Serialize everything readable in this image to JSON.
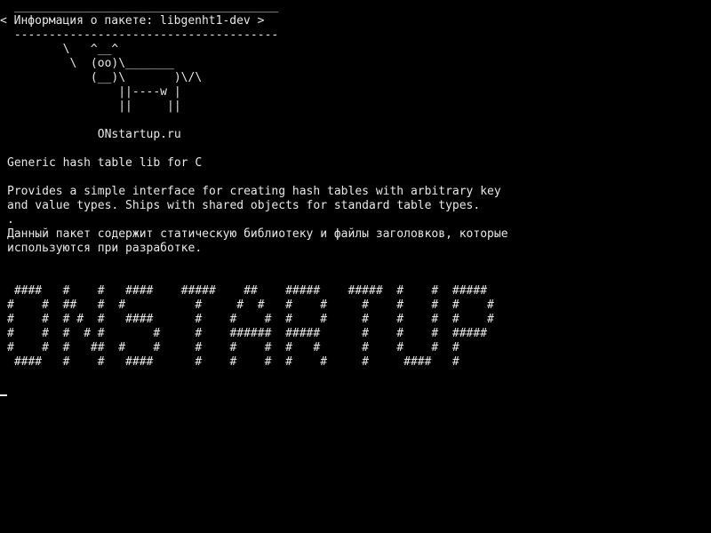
{
  "terminal": {
    "lines": [
      " ______________________________________",
      "< Информация о пакете: libgenht1-dev >",
      " --------------------------------------",
      "        \\   ^__^",
      "         \\  (oo)\\_______",
      "            (__)\\       )\\/\\",
      "                ||----w |",
      "                ||     ||",
      "",
      "             ONstartup.ru",
      "",
      "Generic hash table lib for C",
      "",
      "Provides a simple interface for creating hash tables with arbitrary key",
      "and value types. Ships with shared objects for standard table types.",
      ".",
      "Данный пакет содержит статическую библиотеку и файлы заголовков, которые",
      "используются при разработке.",
      "",
      "",
      " ####   #    #   ####    #####    ##    #####    #####  #    #  #####",
      "#    #  ##   #  #          #     #  #   #    #     #    #    #  #    #",
      "#    #  # #  #   ####      #    #    #  #    #     #    #    #  #    #",
      "#    #  #  # #       #     #    ######  #####      #    #    #  #####",
      "#    #  #   ##  #    #     #    #    #  #   #      #    #    #  #",
      " ####   #    #   ####      #    #    #  #    #     #     ####   #"
    ]
  }
}
